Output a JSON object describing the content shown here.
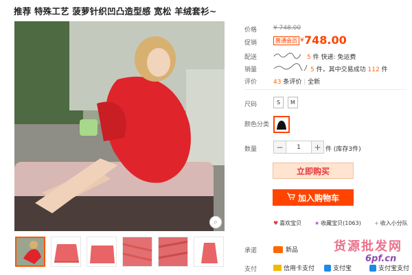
{
  "product": {
    "title": "推荐 特殊工艺 菠萝针织凹凸造型感 宽松 羊绒套衫~"
  },
  "labels": {
    "price": "价格",
    "promo": "促销",
    "shipping": "配送",
    "sales": "销量",
    "reviews": "评价",
    "size": "尺码",
    "color": "颜色分类",
    "quantity": "数量",
    "promise": "承诺",
    "payment": "支付"
  },
  "price": {
    "original": "¥ 748.00",
    "promo_badge": "普通会员",
    "yen": "¥",
    "current": "748.00"
  },
  "shipping": {
    "text": "件 快递: 免运费"
  },
  "sales": {
    "text_prefix": "件，其中交易成功",
    "success_count": "112",
    "text_suffix": "件"
  },
  "reviews": {
    "count": "43",
    "count_suffix": "条评价",
    "sep": "|",
    "all": "全新"
  },
  "sizes": [
    "S",
    "M"
  ],
  "quantity": {
    "minus": "−",
    "value": "1",
    "plus": "+",
    "stock_text": "件 (库存3件)"
  },
  "buttons": {
    "buy_now": "立即购买",
    "add_cart": "加入购物车"
  },
  "actions": {
    "like": "喜欢宝贝",
    "collect": "收藏宝贝(1063)",
    "share": "收入小分队"
  },
  "promise": {
    "text": "新品"
  },
  "payment": {
    "card": "信用卡支付",
    "alipay": "支付宝",
    "ali_more": "支付宝支付"
  },
  "watermark": {
    "line1": "货源批发网",
    "line2": "6pf.cn"
  },
  "colors": {
    "accent": "#ff4400",
    "sweater": "#e0242c"
  },
  "icons": {
    "zoom": "magnifier-icon",
    "heart": "heart-icon",
    "star": "star-icon",
    "plus": "plus-icon",
    "cart": "cart-icon"
  }
}
